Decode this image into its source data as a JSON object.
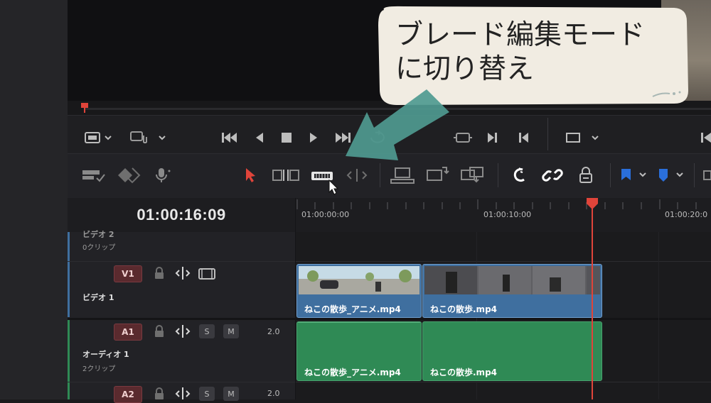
{
  "callout": {
    "line1": "ブレード編集モード",
    "line2": "に切り替え"
  },
  "timeline": {
    "timecode": "01:00:16:09",
    "ruler_labels": [
      "01:00:00:00",
      "01:00:10:00",
      "01:00:20:0"
    ]
  },
  "tracks": {
    "partial_top": {
      "name": "ビデオ 2",
      "clips": "0クリップ"
    },
    "v1": {
      "badge": "V1",
      "name": "ビデオ 1"
    },
    "a1": {
      "badge": "A1",
      "name": "オーディオ 1",
      "clips": "2クリップ",
      "solo": "S",
      "mute": "M",
      "volume": "2.0"
    },
    "a2": {
      "badge": "A2",
      "solo": "S",
      "mute": "M",
      "volume": "2.0"
    }
  },
  "clips": {
    "video": [
      {
        "label": "ねこの散歩_アニメ.mp4"
      },
      {
        "label": "ねこの散歩.mp4"
      }
    ],
    "audio": [
      {
        "label": "ねこの散歩_アニメ.mp4"
      },
      {
        "label": "ねこの散歩.mp4"
      }
    ]
  },
  "colors": {
    "accent_red": "#e0443a",
    "video_clip": "#3f6f9f",
    "audio_clip": "#2f8a55",
    "flag_blue": "#2a6fdb",
    "callout_bg": "#f1ece2",
    "callout_arrow": "#4f9a90"
  },
  "icons": {
    "transport": [
      "viewer-mode-icon",
      "audio-viewer-icon",
      "go-to-start-icon",
      "play-reverse-icon",
      "stop-icon",
      "play-icon",
      "go-to-end-icon",
      "loop-icon"
    ],
    "toolbar": [
      "track-options-icon",
      "diamond-icon",
      "mic-icon",
      "selection-arrow-icon",
      "trim-edit-icon",
      "blade-edit-icon",
      "dynamic-trim-icon",
      "insert-clip-icon",
      "overwrite-clip-icon",
      "replace-clip-icon",
      "snapping-icon",
      "linked-selection-icon",
      "position-lock-icon",
      "flag-icon",
      "marker-icon"
    ]
  }
}
